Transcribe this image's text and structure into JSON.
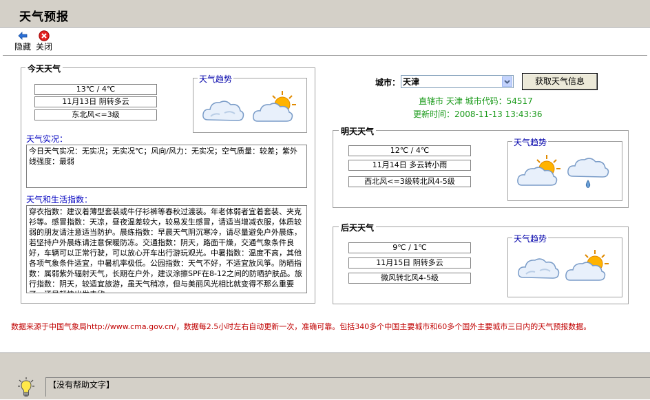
{
  "window": {
    "title": "天气预报"
  },
  "toolbar": {
    "hide_label": "隐藏",
    "close_label": "关闭"
  },
  "today": {
    "title": "今天天气",
    "temp": "13℃ / 4℃",
    "date_weather": "11月13日 阴转多云",
    "wind": "东北风<=3级",
    "trend_label": "天气趋势",
    "icons": [
      "cloud-icon",
      "partly-cloudy-icon"
    ],
    "live_label": "天气实况：",
    "live_text": "今日天气实况：无实况；无实况℃；风向/风力：无实况；空气质量：较差；紫外线强度：最弱",
    "index_label": "天气和生活指数：",
    "index_text": "穿衣指数：建议着薄型套装或牛仔衫裤等春秋过渡装。年老体弱者宜着套装、夹克衫等。感冒指数：天凉，昼夜温差较大，较易发生感冒，请适当增减衣服，体质较弱的朋友请注意适当防护。晨练指数：早晨天气阴沉寒冷，请尽量避免户外晨练，若坚持户外晨练请注意保暖防冻。交通指数：阴天，路面干燥，交通气象条件良好，车辆可以正常行驶，可以放心开车出行游玩观光。中暑指数：温度不高，其他各项气象条件适宜，中暑机率极低。公园指数：天气不好，不适宜放风筝。防晒指数：属弱紫外辐射天气，长期在户外，建议涂擦SPF在8-12之间的防晒护肤品。旅行指数：阴天，较适宜旅游，虽天气稍凉，但与美丽风光相比就变得不那么重要了，还是赶快出发去欣"
  },
  "city": {
    "label": "城市：",
    "selected": "天津",
    "fetch_button": "获取天气信息",
    "info_line": "直辖市 天津  城市代码：54517",
    "update_line": "更新时间：2008-11-13 13:43:36"
  },
  "tomorrow": {
    "title": "明天天气",
    "temp": "12℃ / 4℃",
    "date_weather": "11月14日 多云转小雨",
    "wind": "西北风<=3级转北风4-5级",
    "trend_label": "天气趋势",
    "icons": [
      "partly-cloudy-icon",
      "light-rain-icon"
    ]
  },
  "day_after": {
    "title": "后天天气",
    "temp": "9℃ / 1℃",
    "date_weather": "11月15日 阴转多云",
    "wind": "微风转北风4-5级",
    "trend_label": "天气趋势",
    "icons": [
      "cloud-icon",
      "partly-cloudy-icon"
    ]
  },
  "footer_note": "数据来源于中国气象局http://www.cma.gov.cn/，数据每2.5小时左右自动更新一次，准确可靠。包括340多个中国主要城市和60多个国外主要城市三日内的天气预报数据。",
  "status": {
    "help_text": "【没有帮助文字】"
  }
}
